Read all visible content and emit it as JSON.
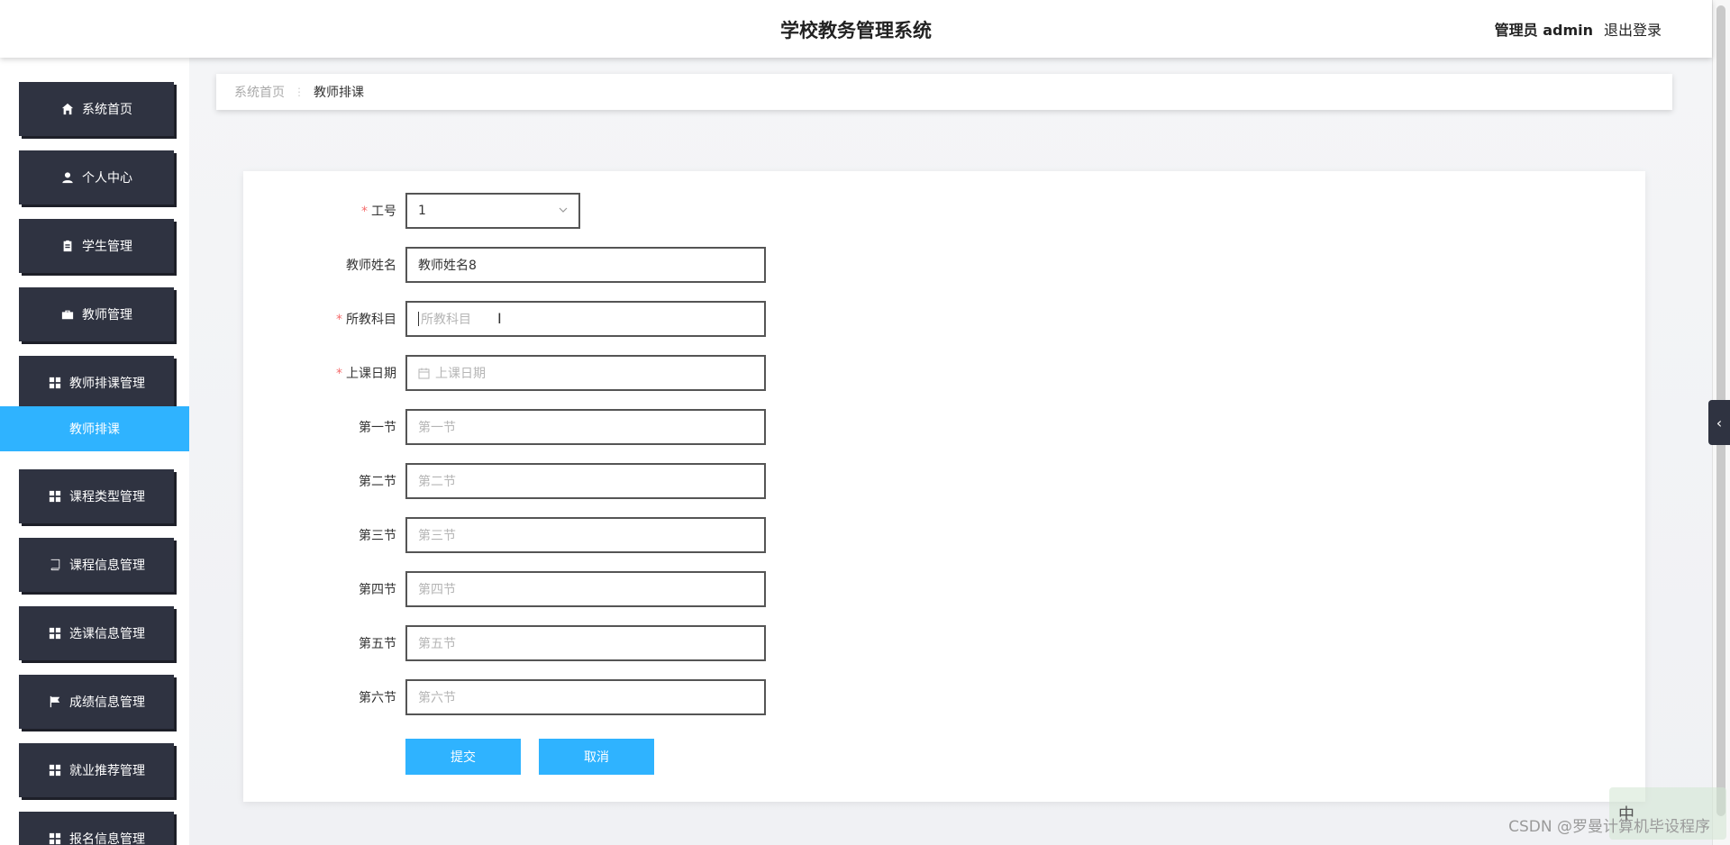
{
  "header": {
    "title": "学校教务管理系统",
    "user": "管理员 admin",
    "logout": "退出登录"
  },
  "sidebar": {
    "items": [
      {
        "label": "系统首页",
        "icon": "home-icon"
      },
      {
        "label": "个人中心",
        "icon": "user-icon"
      },
      {
        "label": "学生管理",
        "icon": "clipboard-icon"
      },
      {
        "label": "教师管理",
        "icon": "briefcase-icon"
      },
      {
        "label": "教师排课管理",
        "icon": "grid-icon"
      },
      {
        "label": "课程类型管理",
        "icon": "grid-icon"
      },
      {
        "label": "课程信息管理",
        "icon": "book-icon"
      },
      {
        "label": "选课信息管理",
        "icon": "grid-icon"
      },
      {
        "label": "成绩信息管理",
        "icon": "flag-icon"
      },
      {
        "label": "就业推荐管理",
        "icon": "grid-icon"
      },
      {
        "label": "报名信息管理",
        "icon": "grid-icon"
      }
    ],
    "active_sub": "教师排课"
  },
  "breadcrumb": {
    "home": "系统首页",
    "current": "教师排课"
  },
  "form": {
    "teacher_no": {
      "label": "工号",
      "value": "1",
      "required": true
    },
    "teacher_name": {
      "label": "教师姓名",
      "value": "教师姓名8"
    },
    "subject": {
      "label": "所教科目",
      "placeholder": "所教科目",
      "required": true
    },
    "class_date": {
      "label": "上课日期",
      "placeholder": "上课日期",
      "required": true
    },
    "p1": {
      "label": "第一节",
      "placeholder": "第一节"
    },
    "p2": {
      "label": "第二节",
      "placeholder": "第二节"
    },
    "p3": {
      "label": "第三节",
      "placeholder": "第三节"
    },
    "p4": {
      "label": "第四节",
      "placeholder": "第四节"
    },
    "p5": {
      "label": "第五节",
      "placeholder": "第五节"
    },
    "p6": {
      "label": "第六节",
      "placeholder": "第六节"
    },
    "submit": "提交",
    "cancel": "取消"
  },
  "ime": "中",
  "watermark": "CSDN @罗曼计算机毕设程序",
  "colors": {
    "accent": "#2fb3ff",
    "menu_bg": "#2f3341",
    "required": "#f56c6c"
  }
}
